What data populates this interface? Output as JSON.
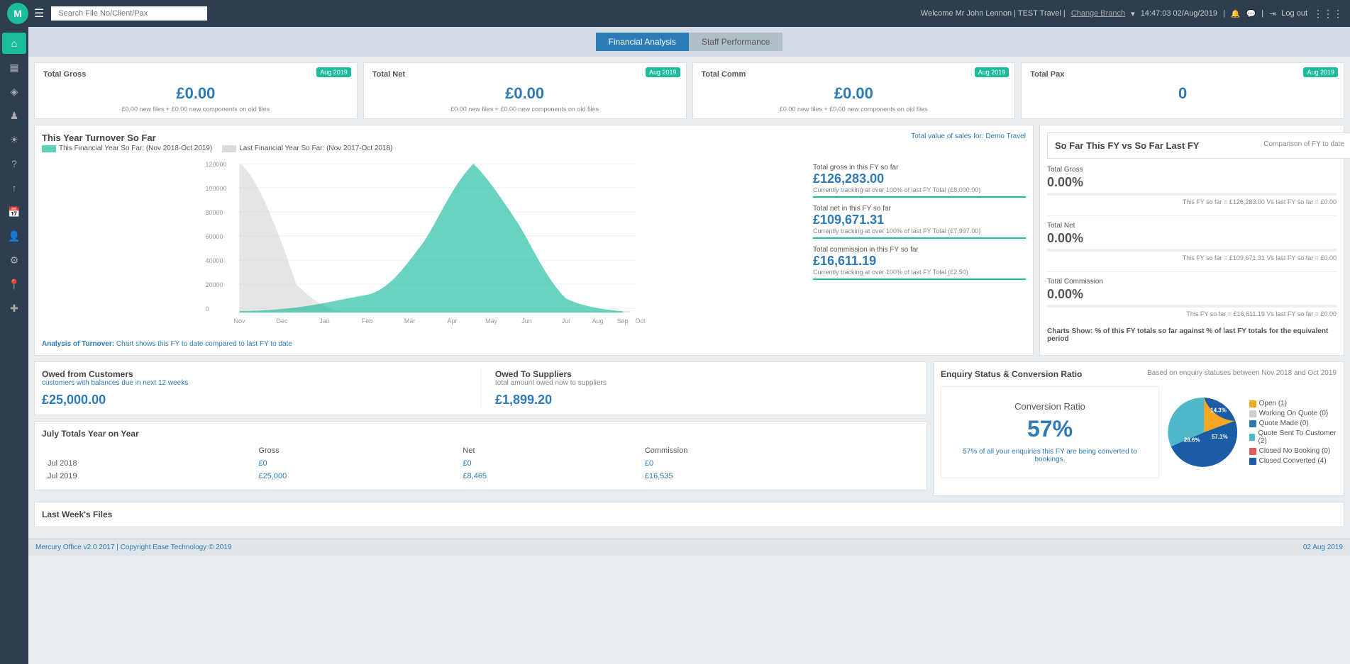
{
  "topNav": {
    "logoText": "M",
    "searchPlaceholder": "Search File No/Client/Pax",
    "welcomeText": "Welcome Mr John Lennon | TEST Travel |",
    "changeBranch": "Change Branch",
    "timeDate": "14:47:03  02/Aug/2019",
    "logoutLabel": "Log out"
  },
  "tabs": {
    "tab1": "Financial Analysis",
    "tab2": "Staff Performance"
  },
  "summaryCards": [
    {
      "title": "Total Gross",
      "badge": "Aug 2019",
      "value": "£0.00",
      "subLine": "£0.00 new files + £0.00 new components on old files"
    },
    {
      "title": "Total Net",
      "badge": "Aug 2019",
      "value": "£0.00",
      "subLine": "£0.00 new files + £0.00 new components on old files"
    },
    {
      "title": "Total Comm",
      "badge": "Aug 2019",
      "value": "£0.00",
      "subLine": "£0.00 new files + £0.00 new components on old files"
    },
    {
      "title": "Total Pax",
      "badge": "Aug 2019",
      "value": "0",
      "subLine": ""
    }
  ],
  "chartSection": {
    "title": "This Year Turnover So Far",
    "subLabel": "Total value of sales for:",
    "subValue": "Demo Travel",
    "legend1": "This Financial Year So Far: (Nov 2018-Oct 2019)",
    "legend2": "Last Financial Year So Far: (Nov 2017-Oct 2018)",
    "stats": [
      {
        "label": "Total gross in this FY so far",
        "value": "£126,283.00",
        "note": "Currently tracking at over 100% of last FY Total (£8,000.00)"
      },
      {
        "label": "Total net in this FY so far",
        "value": "£109,671.31",
        "note": "Currently tracking at over 100% of last FY Total (£7,997.00)"
      },
      {
        "label": "Total commission in this FY so far",
        "value": "£16,611.19",
        "note": "Currently tracking at over 100% of last FY Total (£2.50)"
      }
    ],
    "analysisPrefix": "Analysis of Turnover:",
    "analysisText": "Chart shows this FY to date compared to last FY to date"
  },
  "fyPanel": {
    "title": "So Far This FY vs So Far Last FY",
    "sub": "Comparison of FY to date",
    "stats": [
      {
        "title": "Total Gross",
        "pct": "0.00%",
        "detail": "This FY so far = £126,283.00 Vs last FY so far = £0.00"
      },
      {
        "title": "Total Net",
        "pct": "0.00%",
        "detail": "This FY so far = £109,671.31 Vs last FY so far = £0.00"
      },
      {
        "title": "Total Commission",
        "pct": "0.00%",
        "detail": "This FY so far = £16,611.19 Vs last FY so far = £0.00"
      }
    ],
    "chartsShowPrefix": "Charts Show:",
    "chartsShowText": "% of this FY totals so far against % of last FY totals for the equivalent period"
  },
  "owedFromCustomers": {
    "title": "Owed from Customers",
    "sub": "customers with balances due in next",
    "subHighlight": "12 weeks",
    "value": "£25,000.00"
  },
  "owedToSuppliers": {
    "title": "Owed To Suppliers",
    "sub": "total amount owed now to suppliers",
    "value": "£1,899.20"
  },
  "totalsSection": {
    "title": "July Totals Year on Year",
    "headers": [
      "",
      "Gross",
      "Net",
      "Commission"
    ],
    "rows": [
      {
        "year": "Jul 2018",
        "gross": "£0",
        "net": "£0",
        "commission": "£0"
      },
      {
        "year": "Jul 2019",
        "gross": "£25,000",
        "net": "£8,465",
        "commission": "£16,535"
      }
    ]
  },
  "enquirySection": {
    "title": "Enquiry Status & Conversion Ratio",
    "sub": "Based on enquiry statuses between Nov 2018 and Oct 2019",
    "conversionLabel": "Conversion Ratio",
    "conversionPct": "57%",
    "conversionNote": "57% of all your enquiries this FY are being converted to bookings.",
    "pieData": [
      {
        "label": "Open (1)",
        "color": "#f5a623",
        "pct": 14.3
      },
      {
        "label": "Working On Quote (0)",
        "color": "#ccc",
        "pct": 0
      },
      {
        "label": "Quote Made (0)",
        "color": "#2c7bb6",
        "pct": 0
      },
      {
        "label": "Quote Sent To Customer (2)",
        "color": "#4db8c8",
        "pct": 28.6
      },
      {
        "label": "Closed No Booking (0)",
        "color": "#e05c5c",
        "pct": 0
      },
      {
        "label": "Closed Converted (4)",
        "color": "#1a5da6",
        "pct": 57.1
      }
    ]
  },
  "lastWeek": {
    "title": "Last Week's Files"
  },
  "footer": {
    "left": "Mercury Office v2.0 2017 | Copyright Ease Technology © 2019",
    "right": "02 Aug 2019"
  },
  "sidebar": {
    "items": [
      "⌂",
      "▦",
      "◈",
      "♟",
      "☀",
      "?",
      "↑",
      "📅",
      "👤",
      "⚙",
      "📍",
      "✚"
    ]
  }
}
